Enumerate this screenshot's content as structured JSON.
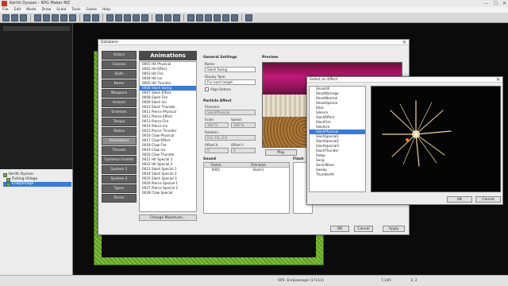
{
  "window": {
    "title": "Kerith Dyssan - RPG Maker MZ",
    "controls": [
      "—",
      "☐",
      "✕"
    ]
  },
  "menu": [
    "File",
    "Edit",
    "Mode",
    "Draw",
    "Scale",
    "Tools",
    "Game",
    "Help"
  ],
  "tree": {
    "items": [
      {
        "label": "Kerith Dyssan",
        "selected": false
      },
      {
        "label": "Fishing Village",
        "selected": false
      },
      {
        "label": "Endpassage",
        "selected": true
      }
    ]
  },
  "status": {
    "map": "005: Endpassage (17x13)",
    "coord1": "7,185",
    "coord2": "3, 2"
  },
  "database": {
    "title": "Database",
    "categories": [
      "Actors",
      "Classes",
      "Skills",
      "Items",
      "Weapons",
      "Armors",
      "Enemies",
      "Troops",
      "States",
      "Animations",
      "Tilesets",
      "Common Events",
      "System 1",
      "System 2",
      "Types",
      "Terms"
    ],
    "active_category": "Animations",
    "list_title": "Animations",
    "animations": [
      "0001 Hit Physical",
      "0002 Hit Effect",
      "0003 Hit Fire",
      "0004 Hit Ice",
      "0005 Hit Thunder",
      "0006 Slash Swing",
      "0007 Slash Effect",
      "0008 Slash Fire",
      "0009 Slash Ice",
      "0010 Slash Thunder",
      "0011 Pierce Physical",
      "0012 Pierce Effect",
      "0013 Pierce Fire",
      "0014 Pierce Ice",
      "0015 Pierce Thunder",
      "0016 Claw Physical",
      "0017 Claw Effect",
      "0018 Claw Fire",
      "0019 Claw Ice",
      "0020 Claw Thunder",
      "0021 Hit Special 1",
      "0022 Hit Special 2",
      "0023 Slash Special 1",
      "0024 Slash Special 2",
      "0025 Slash Special 3",
      "0026 Pierce Special 1",
      "0027 Pierce Special 2",
      "0028 Claw Special"
    ],
    "selected_index": 5,
    "change_max": "Change Maximum...",
    "general": {
      "header": "General Settings",
      "name_label": "Name:",
      "name_value": "Slash Swing",
      "display_label": "Display Type:",
      "display_value": "For each target",
      "align_label": "Align Bottom"
    },
    "particle": {
      "header": "Particle Effect",
      "filename_label": "Filename:",
      "filename_value": "SlashPhysical",
      "scale_label": "Scale:",
      "scale_value": "100 %",
      "speed_label": "Speed:",
      "speed_value": "100 %",
      "rotation_label": "Rotation:",
      "rotation_value": "0.0, Y:0, Z:0",
      "offsetx_label": "Offset X:",
      "offsetx_value": "0",
      "offsety_label": "Offset Y:",
      "offsety_value": "0"
    },
    "preview": {
      "header": "Preview",
      "play": "Play"
    },
    "sound": {
      "header": "Sound",
      "col_frame": "Frame",
      "col_file": "Filename",
      "rows": [
        {
          "frame": "0001",
          "file": "Slash1"
        }
      ]
    },
    "flash": {
      "header": "Flash"
    },
    "buttons": {
      "ok": "OK",
      "cancel": "Cancel",
      "apply": "Apply"
    }
  },
  "effect_dialog": {
    "title": "Select an Effect",
    "items": [
      "ShootAll",
      "ShootBarrage",
      "ShootNormal",
      "ShootSpecial",
      "Shot",
      "Silence",
      "SlashEffect",
      "SlashFire",
      "SlashIce",
      "SlashPhysical",
      "SlashSpecial1",
      "SlashSpecial2",
      "SlashSpecial3",
      "SlashThunder",
      "Sleep",
      "Song",
      "SonicWave",
      "Sweep",
      "ThunderAll"
    ],
    "selected": "SlashPhysical",
    "ok": "OK",
    "cancel": "Cancel"
  }
}
